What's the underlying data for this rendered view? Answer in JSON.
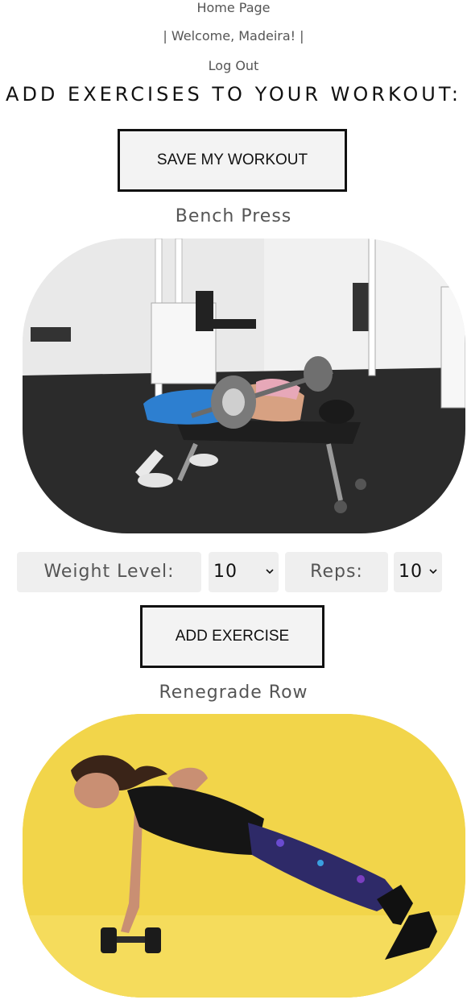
{
  "nav": {
    "home": "Home Page",
    "welcome": "|  Welcome, Madeira!  |",
    "logout": "Log Out"
  },
  "headline": "ADD EXERCISES TO YOUR WORKOUT:",
  "save_button": "SAVE MY WORKOUT",
  "exercises": [
    {
      "title": "Bench Press",
      "weight_label": "Weight Level:",
      "weight_value": "10",
      "reps_label": "Reps:",
      "reps_value": "10",
      "add_button": "ADD EXERCISE"
    },
    {
      "title": "Renegrade Row"
    }
  ],
  "colors": {
    "text": "#555555",
    "accent_dark": "#111111",
    "control_bg": "#efefef",
    "yellow_bg": "#f2d54a"
  }
}
